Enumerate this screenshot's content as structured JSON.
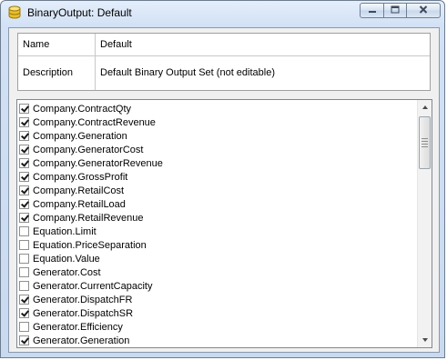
{
  "window": {
    "title": "BinaryOutput: Default"
  },
  "colors": {
    "title_bar": "#d2e1f5",
    "client_bg": "#f0f0f0",
    "check": "#1a1a1a"
  },
  "icons": {
    "app": "database-icon",
    "minimize": "minimize-icon",
    "maximize": "maximize-icon",
    "close": "close-icon"
  },
  "properties": [
    {
      "label": "Name",
      "value": "Default"
    },
    {
      "label": "Description",
      "value": "Default Binary Output Set (not editable)"
    }
  ],
  "output_list": {
    "items": [
      {
        "label": "Company.ContractQty",
        "checked": true
      },
      {
        "label": "Company.ContractRevenue",
        "checked": true
      },
      {
        "label": "Company.Generation",
        "checked": true
      },
      {
        "label": "Company.GeneratorCost",
        "checked": true
      },
      {
        "label": "Company.GeneratorRevenue",
        "checked": true
      },
      {
        "label": "Company.GrossProfit",
        "checked": true
      },
      {
        "label": "Company.RetailCost",
        "checked": true
      },
      {
        "label": "Company.RetailLoad",
        "checked": true
      },
      {
        "label": "Company.RetailRevenue",
        "checked": true
      },
      {
        "label": "Equation.Limit",
        "checked": false
      },
      {
        "label": "Equation.PriceSeparation",
        "checked": false
      },
      {
        "label": "Equation.Value",
        "checked": false
      },
      {
        "label": "Generator.Cost",
        "checked": false
      },
      {
        "label": "Generator.CurrentCapacity",
        "checked": false
      },
      {
        "label": "Generator.DispatchFR",
        "checked": true
      },
      {
        "label": "Generator.DispatchSR",
        "checked": true
      },
      {
        "label": "Generator.Efficiency",
        "checked": false
      },
      {
        "label": "Generator.Generation",
        "checked": true
      }
    ]
  }
}
